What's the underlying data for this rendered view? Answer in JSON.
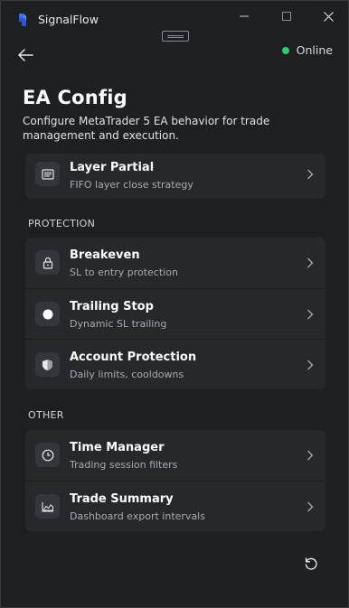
{
  "window": {
    "app_title": "SignalFlow",
    "logo_icon": "signalflow-logo-icon",
    "controls": [
      "minimize-icon",
      "maximize-icon",
      "close-icon"
    ]
  },
  "header": {
    "status_label": "Online",
    "status_color": "#2ecc71",
    "back_icon": "arrow-left-icon"
  },
  "page": {
    "title": "EA Config",
    "description": "Configure MetaTrader 5 EA behavior for trade management and execution."
  },
  "sections": {
    "top": {
      "items": [
        {
          "title": "Layer Partial",
          "subtitle": "FIFO layer close strategy",
          "icon": "layers-icon"
        }
      ]
    },
    "protection": {
      "label": "PROTECTION",
      "items": [
        {
          "title": "Breakeven",
          "subtitle": "SL to entry protection",
          "icon": "lock-icon"
        },
        {
          "title": "Trailing Stop",
          "subtitle": "Dynamic SL trailing",
          "icon": "circle-icon"
        },
        {
          "title": "Account Protection",
          "subtitle": "Daily limits, cooldowns",
          "icon": "shield-icon"
        }
      ]
    },
    "other": {
      "label": "OTHER",
      "items": [
        {
          "title": "Time Manager",
          "subtitle": "Trading session filters",
          "icon": "clock-icon"
        },
        {
          "title": "Trade Summary",
          "subtitle": "Dashboard export intervals",
          "icon": "chart-area-icon"
        }
      ]
    }
  },
  "footer": {
    "reset_icon": "reset-icon"
  },
  "colors": {
    "background": "#1e1f22",
    "card": "#27282c",
    "accent_online": "#2ecc71"
  }
}
